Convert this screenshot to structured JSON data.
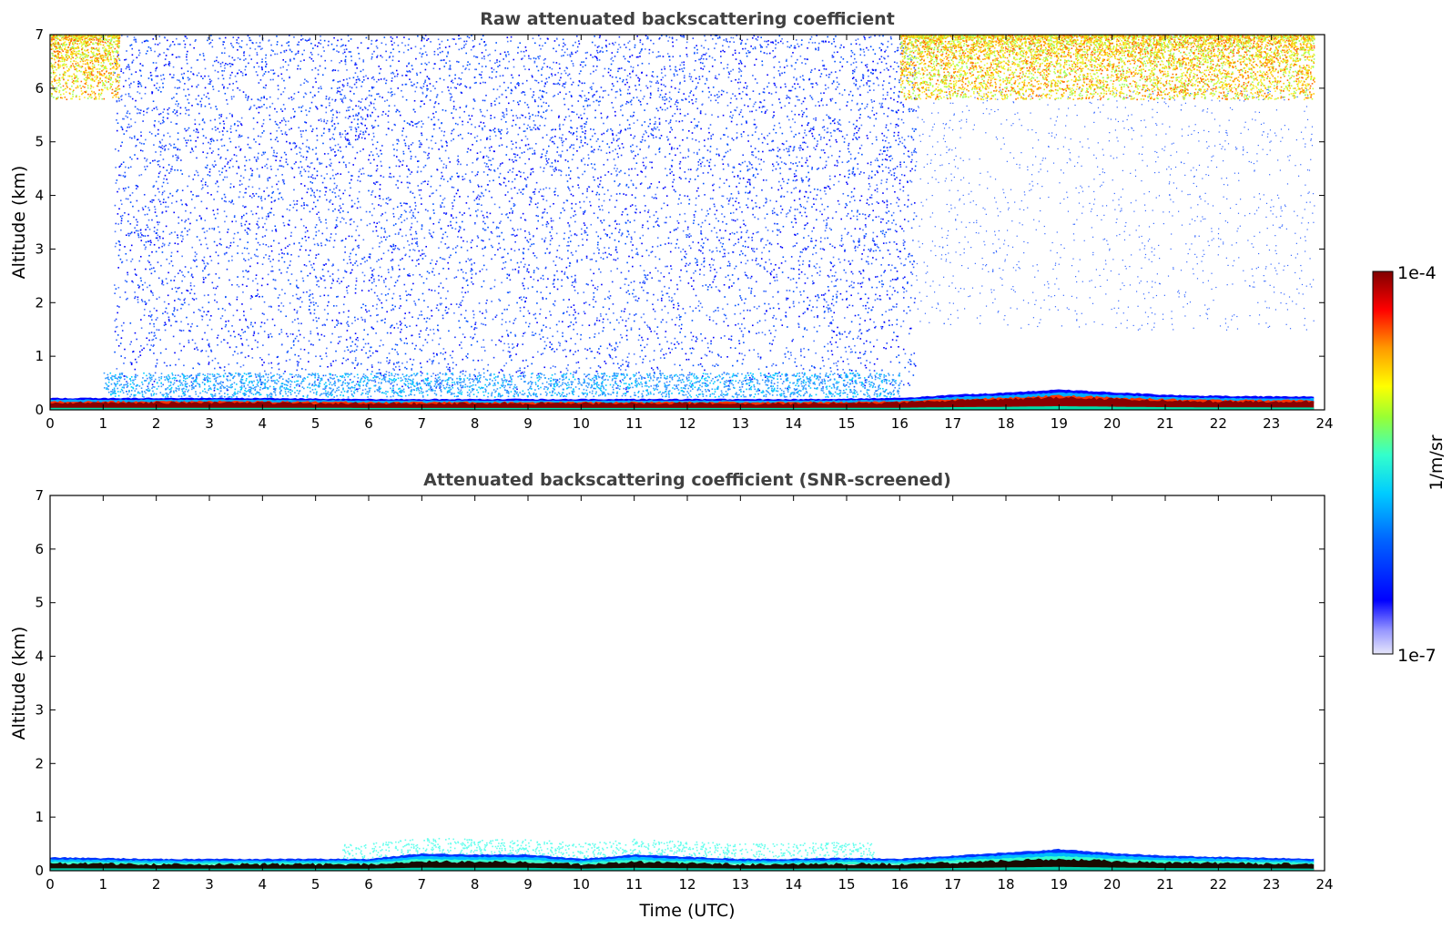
{
  "chart_data": [
    {
      "type": "heatmap",
      "title": "Raw attenuated backscattering coefficient",
      "xlabel": "",
      "ylabel": "Altitude (km)",
      "xlim": [
        0,
        24
      ],
      "ylim": [
        0,
        7
      ],
      "xticks": [
        "0",
        "1",
        "2",
        "3",
        "4",
        "5",
        "6",
        "7",
        "8",
        "9",
        "10",
        "11",
        "12",
        "13",
        "14",
        "15",
        "16",
        "17",
        "18",
        "19",
        "20",
        "21",
        "22",
        "23",
        "24"
      ],
      "yticks": [
        "0",
        "1",
        "2",
        "3",
        "4",
        "5",
        "6",
        "7"
      ],
      "features": {
        "boundary_layer_top_km": [
          [
            0,
            0.22
          ],
          [
            2,
            0.22
          ],
          [
            4,
            0.22
          ],
          [
            6,
            0.2
          ],
          [
            8,
            0.2
          ],
          [
            10,
            0.2
          ],
          [
            12,
            0.2
          ],
          [
            14,
            0.2
          ],
          [
            16,
            0.22
          ],
          [
            17,
            0.28
          ],
          [
            18,
            0.32
          ],
          [
            19,
            0.38
          ],
          [
            20,
            0.33
          ],
          [
            21,
            0.28
          ],
          [
            22,
            0.26
          ],
          [
            23,
            0.25
          ],
          [
            23.8,
            0.25
          ]
        ],
        "noise_region_hours": [
          [
            1.2,
            16.3
          ]
        ],
        "high_altitude_noise_hours": [
          [
            0,
            1.3
          ],
          [
            16.0,
            23.8
          ]
        ],
        "data_end_hour": 23.8
      }
    },
    {
      "type": "heatmap",
      "title": "Attenuated backscattering coefficient (SNR-screened)",
      "xlabel": "Time (UTC)",
      "ylabel": "Altitude (km)",
      "xlim": [
        0,
        24
      ],
      "ylim": [
        0,
        7
      ],
      "xticks": [
        "0",
        "1",
        "2",
        "3",
        "4",
        "5",
        "6",
        "7",
        "8",
        "9",
        "10",
        "11",
        "12",
        "13",
        "14",
        "15",
        "16",
        "17",
        "18",
        "19",
        "20",
        "21",
        "22",
        "23",
        "24"
      ],
      "yticks": [
        "0",
        "1",
        "2",
        "3",
        "4",
        "5",
        "6",
        "7"
      ],
      "features": {
        "boundary_layer_top_km": [
          [
            0,
            0.25
          ],
          [
            2,
            0.22
          ],
          [
            4,
            0.22
          ],
          [
            6,
            0.22
          ],
          [
            7,
            0.32
          ],
          [
            8,
            0.3
          ],
          [
            9,
            0.3
          ],
          [
            10,
            0.22
          ],
          [
            11,
            0.3
          ],
          [
            12,
            0.26
          ],
          [
            13,
            0.22
          ],
          [
            14,
            0.22
          ],
          [
            15,
            0.24
          ],
          [
            16,
            0.22
          ],
          [
            17,
            0.28
          ],
          [
            18,
            0.34
          ],
          [
            19,
            0.4
          ],
          [
            20,
            0.33
          ],
          [
            21,
            0.28
          ],
          [
            22,
            0.26
          ],
          [
            23,
            0.24
          ],
          [
            23.8,
            0.22
          ]
        ],
        "data_end_hour": 23.8
      }
    }
  ],
  "colorbar": {
    "label": "1/m/sr",
    "max_label": "1e-4",
    "min_label": "1e-7",
    "scale": "log",
    "colormap": "jet"
  }
}
